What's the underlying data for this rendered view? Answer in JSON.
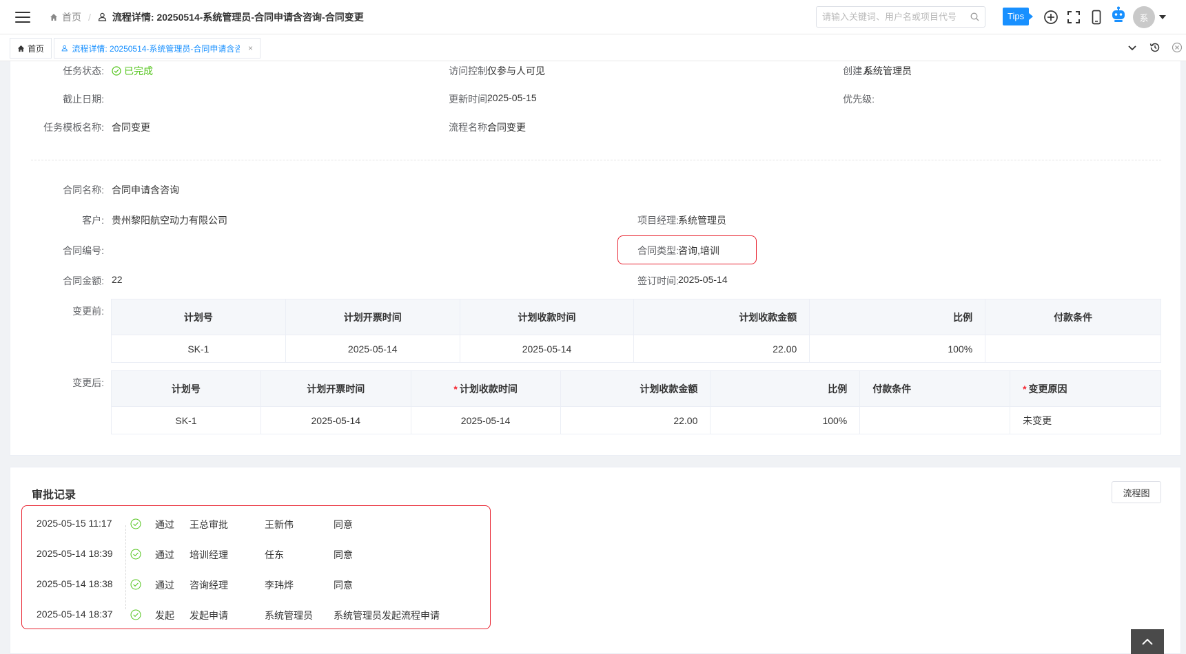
{
  "header": {
    "breadcrumb_home": "首页",
    "breadcrumb_current": "流程详情: 20250514-系统管理员-合同申请含咨询-合同变更",
    "search_placeholder": "请输入关键词、用户名或项目代号",
    "tips_label": "Tips",
    "avatar_text": "系"
  },
  "tabs": {
    "home": "首页",
    "active": "流程详情: 20250514-系统管理员-合同申请含咨询-合同变更",
    "close": "×"
  },
  "task": {
    "status_label": "任务状态:",
    "status_value": "已完成",
    "access_label": "访问控制:",
    "access_value": "仅参与人可见",
    "creator_label": "创建人:",
    "creator_value": "系统管理员",
    "deadline_label": "截止日期:",
    "deadline_value": "",
    "updated_label": "更新时间:",
    "updated_value": "2025-05-15",
    "priority_label": "优先级:",
    "priority_value": "",
    "template_label": "任务模板名称:",
    "template_value": "合同变更",
    "process_label": "流程名称:",
    "process_value": "合同变更"
  },
  "contract": {
    "name_label": "合同名称:",
    "name_value": "合同申请含咨询",
    "customer_label": "客户:",
    "customer_value": "贵州黎阳航空动力有限公司",
    "pm_label": "项目经理:",
    "pm_value": "系统管理员",
    "number_label": "合同编号:",
    "number_value": "",
    "type_label": "合同类型:",
    "type_value": "咨询,培训",
    "amount_label": "合同金额:",
    "amount_value": "22",
    "signed_label": "签订时间:",
    "signed_value": "2025-05-14"
  },
  "before": {
    "label": "变更前:",
    "headers": [
      "计划号",
      "计划开票时间",
      "计划收款时间",
      "计划收款金额",
      "比例",
      "付款条件"
    ],
    "rows": [
      [
        "SK-1",
        "2025-05-14",
        "2025-05-14",
        "22.00",
        "100%",
        ""
      ]
    ]
  },
  "after": {
    "label": "变更后:",
    "headers": [
      "计划号",
      "计划开票时间",
      "计划收款时间",
      "计划收款金额",
      "比例",
      "付款条件",
      "变更原因"
    ],
    "required_mark": "*",
    "rows": [
      [
        "SK-1",
        "2025-05-14",
        "2025-05-14",
        "22.00",
        "100%",
        "",
        "未变更"
      ]
    ]
  },
  "approval": {
    "title": "审批记录",
    "flow_button": "流程图",
    "records": [
      {
        "time": "2025-05-15 11:17",
        "action": "通过",
        "step": "王总审批",
        "user": "王新伟",
        "comment": "同意"
      },
      {
        "time": "2025-05-14 18:39",
        "action": "通过",
        "step": "培训经理",
        "user": "任东",
        "comment": "同意"
      },
      {
        "time": "2025-05-14 18:38",
        "action": "通过",
        "step": "咨询经理",
        "user": "李玮烨",
        "comment": "同意"
      },
      {
        "time": "2025-05-14 18:37",
        "action": "发起",
        "step": "发起申请",
        "user": "系统管理员",
        "comment": "系统管理员发起流程申请"
      }
    ]
  },
  "colors": {
    "accent": "#1890ff",
    "success": "#52c41a",
    "highlight_box": "#e8212e"
  }
}
